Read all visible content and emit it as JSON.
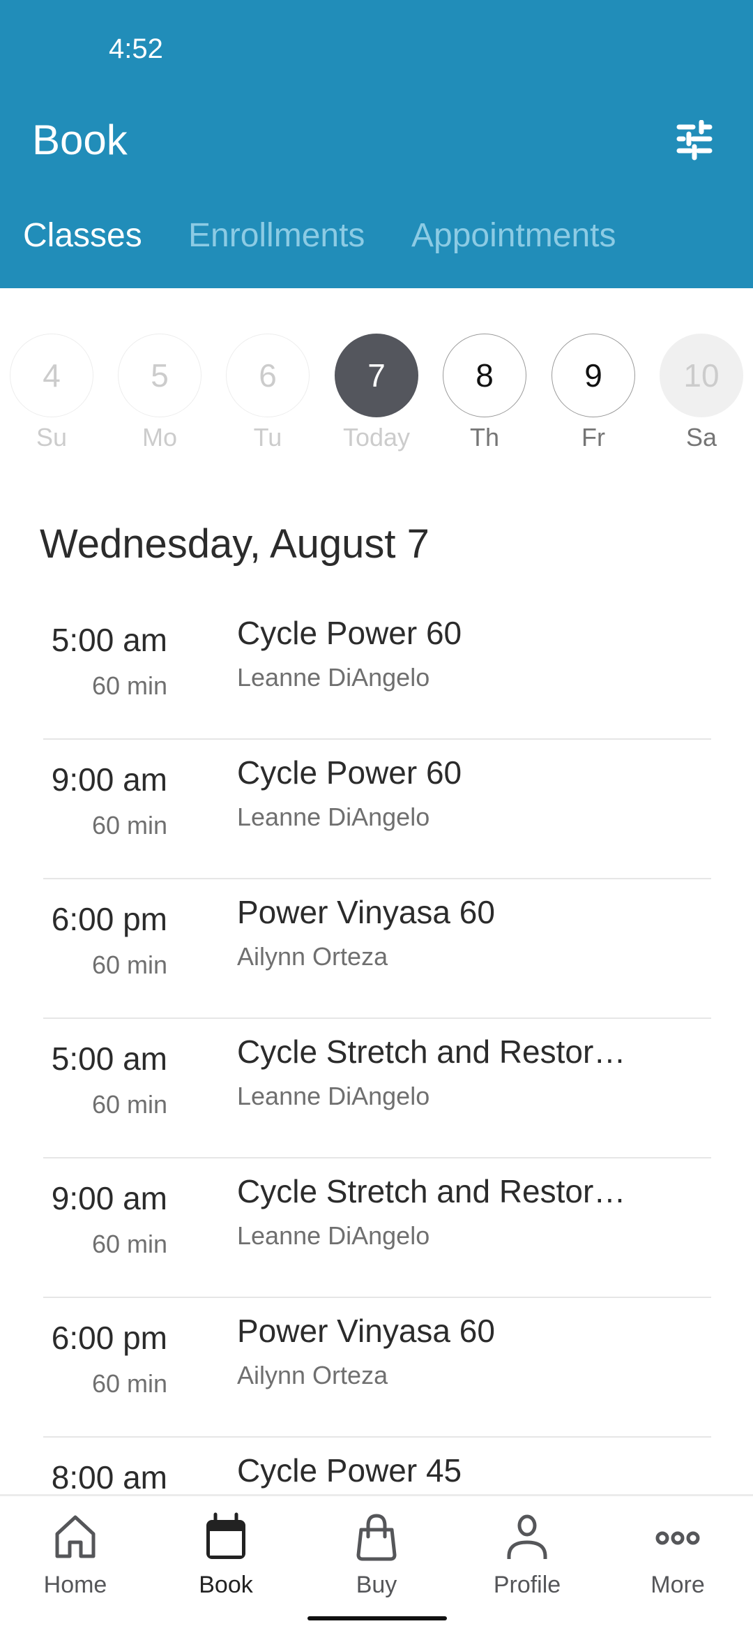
{
  "status_bar": {
    "time": "4:52"
  },
  "header": {
    "title": "Book",
    "filter_icon": "sliders-icon",
    "tabs": [
      {
        "label": "Classes",
        "active": true
      },
      {
        "label": "Enrollments",
        "active": false
      },
      {
        "label": "Appointments",
        "active": false
      }
    ]
  },
  "date_strip": {
    "days": [
      {
        "number": "4",
        "label": "Su",
        "state": "past"
      },
      {
        "number": "5",
        "label": "Mo",
        "state": "past"
      },
      {
        "number": "6",
        "label": "Tu",
        "state": "past"
      },
      {
        "number": "7",
        "label": "Today",
        "state": "selected"
      },
      {
        "number": "8",
        "label": "Th",
        "state": "future"
      },
      {
        "number": "9",
        "label": "Fr",
        "state": "future"
      },
      {
        "number": "10",
        "label": "Sa",
        "state": "disabled"
      }
    ]
  },
  "schedule": {
    "date_heading": "Wednesday, August 7",
    "classes": [
      {
        "time": "5:00 am",
        "duration": "60 min",
        "name": "Cycle Power 60",
        "instructor": "Leanne DiAngelo"
      },
      {
        "time": "9:00 am",
        "duration": "60 min",
        "name": "Cycle Power 60",
        "instructor": "Leanne DiAngelo"
      },
      {
        "time": "6:00 pm",
        "duration": "60 min",
        "name": "Power Vinyasa 60",
        "instructor": "Ailynn Orteza"
      },
      {
        "time": "5:00 am",
        "duration": "60 min",
        "name": "Cycle Stretch and Restor…",
        "instructor": "Leanne DiAngelo"
      },
      {
        "time": "9:00 am",
        "duration": "60 min",
        "name": "Cycle Stretch and Restor…",
        "instructor": "Leanne DiAngelo"
      },
      {
        "time": "6:00 pm",
        "duration": "60 min",
        "name": "Power Vinyasa 60",
        "instructor": "Ailynn Orteza"
      },
      {
        "time": "8:00 am",
        "duration": "",
        "name": "Cycle Power 45",
        "instructor": ""
      }
    ]
  },
  "bottom_nav": {
    "items": [
      {
        "label": "Home",
        "icon": "home-icon",
        "active": false
      },
      {
        "label": "Book",
        "icon": "calendar-icon",
        "active": true
      },
      {
        "label": "Buy",
        "icon": "shopping-bag-icon",
        "active": false
      },
      {
        "label": "Profile",
        "icon": "person-icon",
        "active": false
      },
      {
        "label": "More",
        "icon": "more-dots-icon",
        "active": false
      }
    ]
  },
  "colors": {
    "header_bg": "#218db9",
    "selected_day": "#54565d",
    "inactive_tab": "#8ccbe4"
  }
}
